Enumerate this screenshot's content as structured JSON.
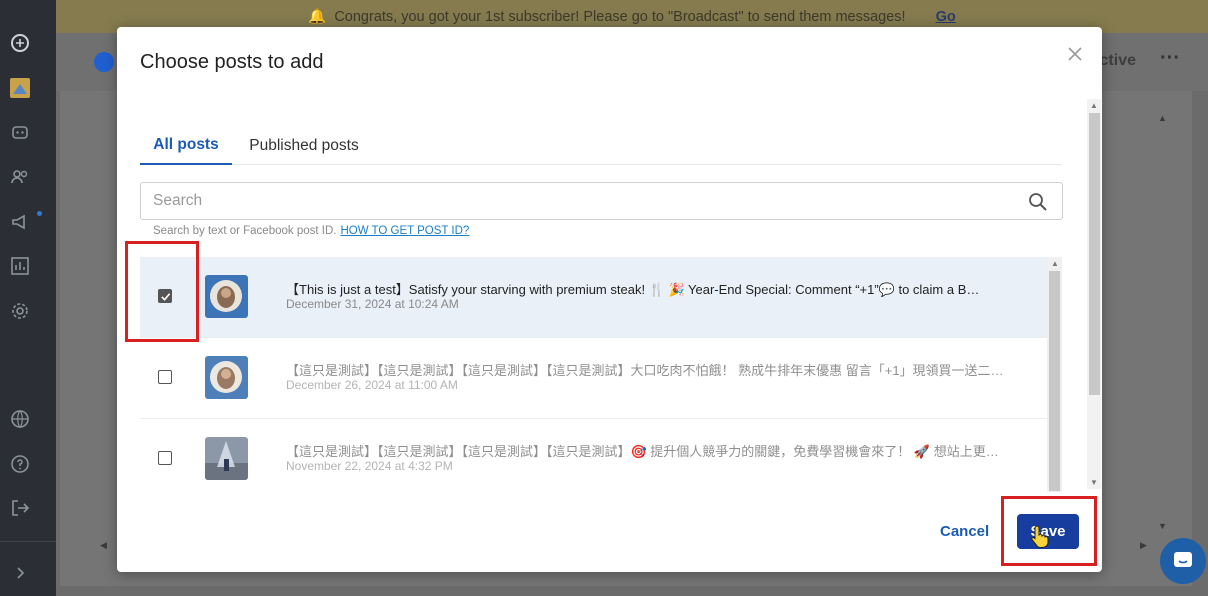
{
  "banner": {
    "message": "Congrats, you got your 1st subscriber! Please go to \"Broadcast\" to send them messages!",
    "link": "Go"
  },
  "app_header": {
    "active_text": "ctive",
    "more": "···"
  },
  "sidebar": {
    "icons": [
      "logo-icon",
      "avatar-icon",
      "bot-icon",
      "users-icon",
      "broadcast-icon",
      "analytics-icon",
      "settings-icon",
      "globe-icon",
      "help-icon",
      "logout-icon",
      "expand-icon"
    ]
  },
  "modal": {
    "title": "Choose posts to add",
    "tabs": [
      {
        "label": "All posts",
        "active": true
      },
      {
        "label": "Published posts",
        "active": false
      }
    ],
    "search": {
      "placeholder": "Search",
      "help_text": "Search by text or Facebook post ID.",
      "help_link": "HOW TO GET POST ID?"
    },
    "posts": [
      {
        "text": "【This is just a test】Satisfy your starving with premium steak! 🍴 🎉 Year-End Special: Comment “+1”💬 to claim a B…",
        "date": "December 31, 2024 at 10:24 AM",
        "checked": true
      },
      {
        "text": "【這只是測試】【這只是測試】【這只是測試】【這只是測試】大口吃肉不怕餓！ 熟成牛排年末優惠 留言「+1」現領買一送二…",
        "date": "December 26, 2024 at 11:00 AM",
        "checked": false
      },
      {
        "text": "【這只是測試】【這只是測試】【這只是測試】【這只是測試】🎯 提升個人競爭力的關鍵，免費學習機會來了！ 🚀 想站上更…",
        "date": "November 22, 2024 at 4:32 PM",
        "checked": false
      }
    ],
    "cancel_label": "Cancel",
    "save_label": "Save"
  },
  "colors": {
    "accent": "#1b5bb5",
    "save_button": "#173e9e",
    "highlight": "#d92020",
    "selected_row": "#e9f0f8"
  }
}
